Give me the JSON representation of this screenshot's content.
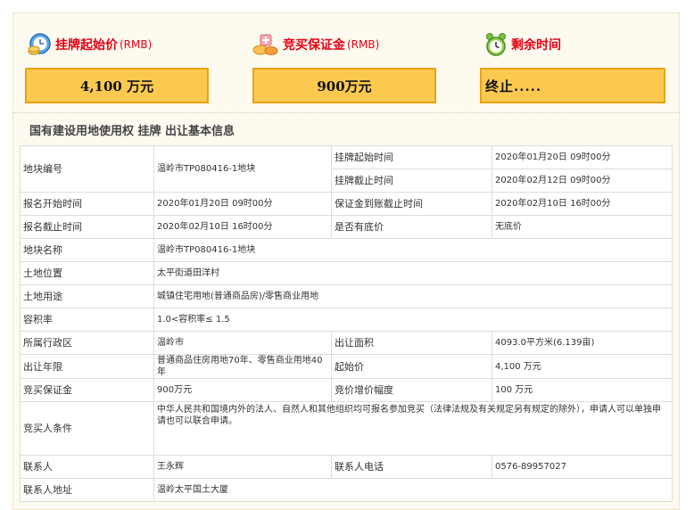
{
  "header": {
    "start_price_label": "挂牌起始价",
    "start_price_unit": "(RMB)",
    "deposit_label": "竞买保证金",
    "deposit_unit": "(RMB)",
    "remaining_label": "剩余时间"
  },
  "boxes": {
    "start_price": "4,100 万元",
    "deposit": "900万元",
    "remaining": "终止....."
  },
  "subtitle": "国有建设用地使用权 挂牌 出让基本信息",
  "rows": {
    "plot_no_label": "地块编号",
    "plot_no": "温岭市TP080416-1地块",
    "listing_start_label": "挂牌起始时间",
    "listing_start": "2020年01月20日 09时00分",
    "listing_end_label": "挂牌截止时间",
    "listing_end": "2020年02月12日 09时00分",
    "signup_start_label": "报名开始时间",
    "signup_start": "2020年01月20日 09时00分",
    "deposit_deadline_label": "保证金到账截止时间",
    "deposit_deadline": "2020年02月10日 16时00分",
    "signup_end_label": "报名截止时间",
    "signup_end": "2020年02月10日 16时00分",
    "reserve_label": "是否有底价",
    "reserve": "无底价",
    "plot_name_label": "地块名称",
    "plot_name": "温岭市TP080416-1地块",
    "location_label": "土地位置",
    "location": "太平街道田洋村",
    "usage_label": "土地用途",
    "usage": "城镇住宅用地(普通商品房)/零售商业用地",
    "far_label": "容积率",
    "far": "1.0<容积率≤ 1.5",
    "district_label": "所属行政区",
    "district": "温岭市",
    "area_label": "出让面积",
    "area": "4093.0平方米(6.139亩)",
    "term_label": "出让年限",
    "term": "普通商品住房用地70年、零售商业用地40年",
    "start_price_label": "起始价",
    "start_price": "4,100 万元",
    "deposit_label": "竞买保证金",
    "deposit": "900万元",
    "increment_label": "竞价增价幅度",
    "increment": "100 万元",
    "condition_label": "竞买人条件",
    "condition": "中华人民共和国境内外的法人、自然人和其他组织均可报名参加竞买（法律法规及有关规定另有规定的除外），申请人可以单独申请也可以联合申请。",
    "contact_label": "联系人",
    "contact": "王永辉",
    "phone_label": "联系人电话",
    "phone": "0576-89957027",
    "address_label": "联系人地址",
    "address": "温岭太平国土大厦"
  }
}
